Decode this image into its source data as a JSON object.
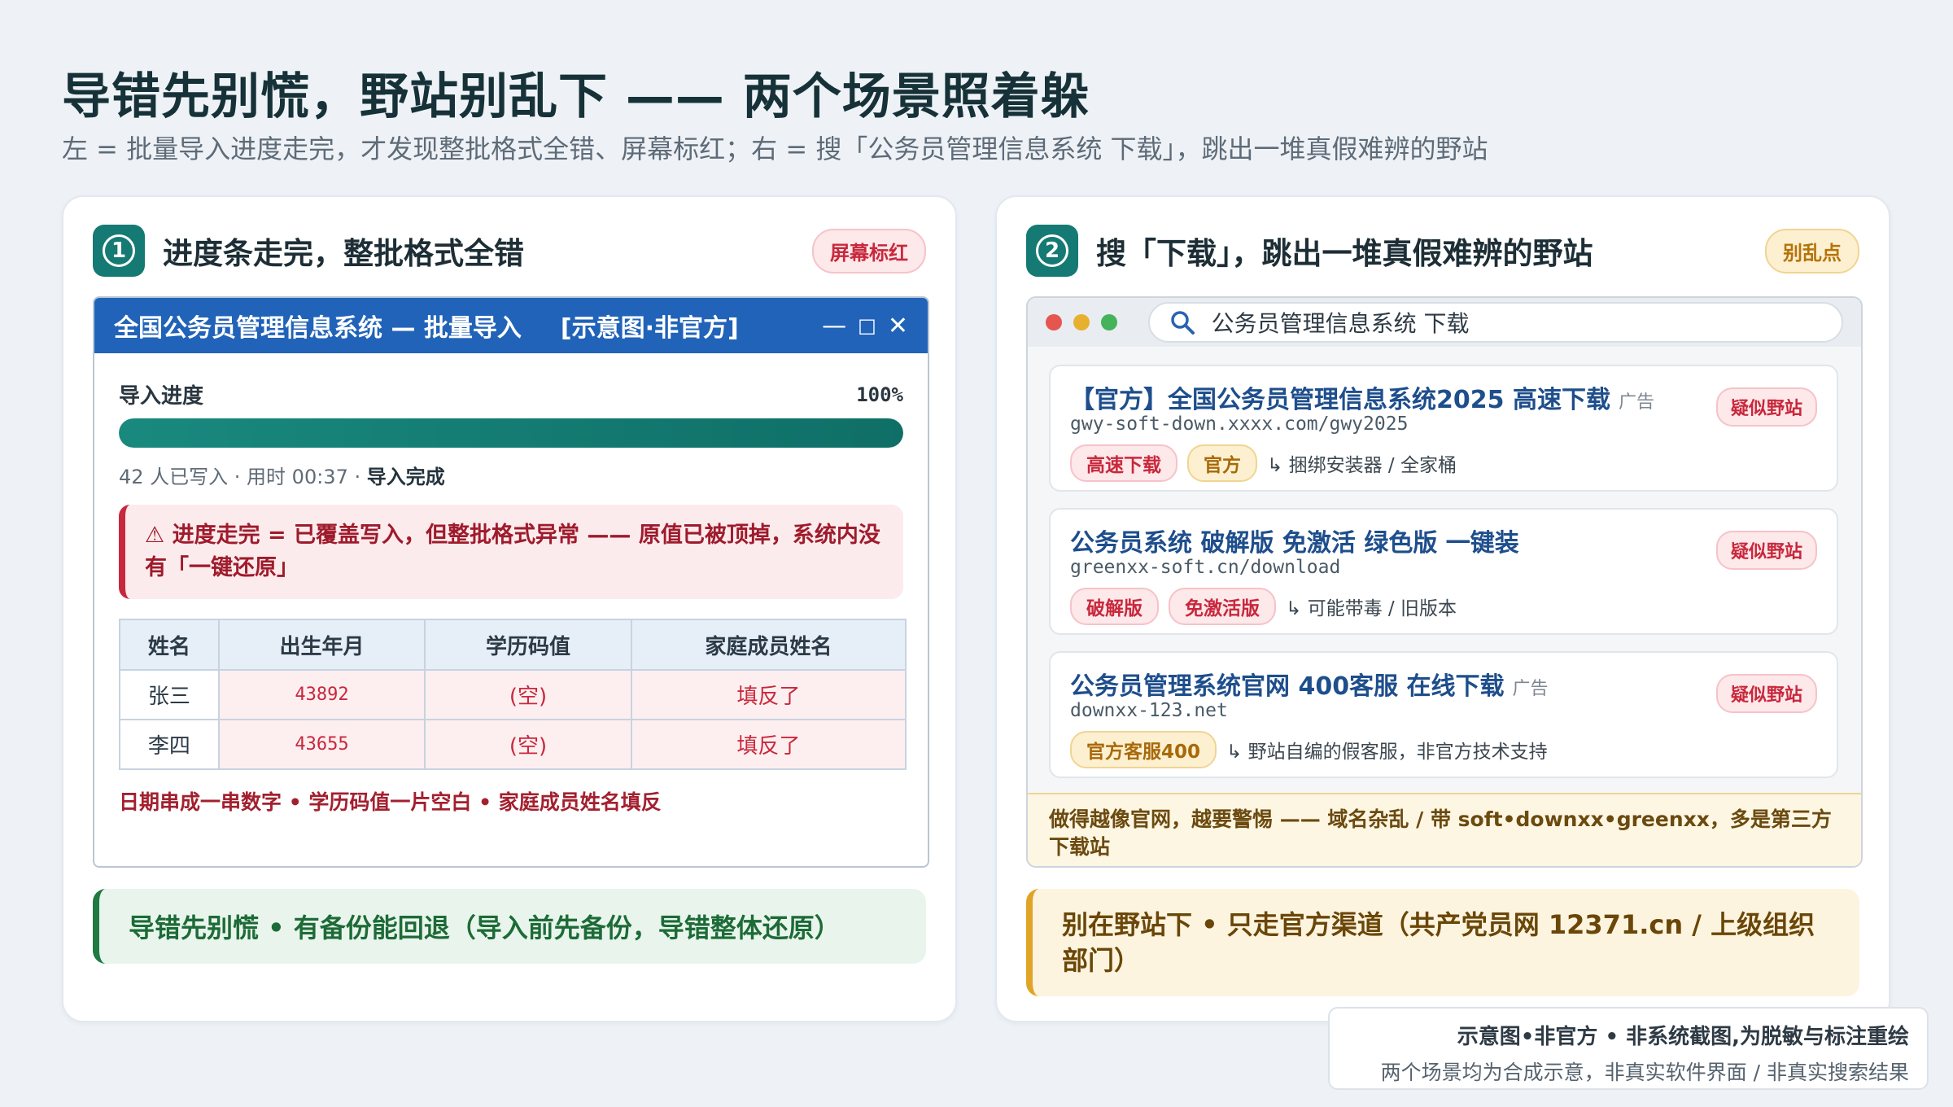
{
  "header": {
    "title": "导错先别慌，野站别乱下 —— 两个场景照着躲",
    "subtitle": "左 = 批量导入进度走完，才发现整批格式全错、屏幕标红；右 = 搜「公务员管理信息系统 下载」，跳出一堆真假难辨的野站"
  },
  "left": {
    "badge": "1",
    "title": "进度条走完，整批格式全错",
    "tag": "屏幕标红",
    "window": {
      "title": "全国公务员管理信息系统 — 批量导入",
      "tag": "[示意图·非官方]",
      "controls": {
        "minimize": "—",
        "maximize": "□",
        "close": "✕"
      },
      "progress_label": "导入进度",
      "progress_pct_text": "100%",
      "progress_value": 1.0,
      "meta_text": "42 人已写入 · 用时 00:37 · ",
      "meta_status": "导入完成",
      "alert": "⚠ 进度走完 = 已覆盖写入，但整批格式异常 —— 原值已被顶掉，系统内没有「一键还原」",
      "table": {
        "headers": [
          "姓名",
          "出生年月",
          "学历码值",
          "家庭成员姓名"
        ],
        "rows": [
          [
            "张三",
            "43892",
            "(空)",
            "填反了"
          ],
          [
            "李四",
            "43655",
            "(空)",
            "填反了"
          ]
        ]
      },
      "footer": "日期串成一串数字 • 学历码值一片空白 • 家庭成员姓名填反"
    },
    "callout": "导错先别慌 • 有备份能回退（导入前先备份，导错整体还原）"
  },
  "right": {
    "badge": "2",
    "title": "搜「下载」，跳出一堆真假难辨的野站",
    "tag": "别乱点",
    "browser": {
      "search_query": "公务员管理信息系统 下载",
      "results": [
        {
          "title": "【官方】全国公务员管理信息系统2025 高速下载",
          "ad": "广告",
          "url": "gwy-soft-down.xxxx.com/gwy2025",
          "chips": [
            {
              "text": "高速下载",
              "style": "red"
            },
            {
              "text": "官方",
              "style": "amber"
            }
          ],
          "note": "↳ 捆绑安装器 / 全家桶",
          "flag": "疑似野站"
        },
        {
          "title": "公务员系统 破解版 免激活 绿色版 一键装",
          "ad": "",
          "url": "greenxx-soft.cn/download",
          "chips": [
            {
              "text": "破解版",
              "style": "red"
            },
            {
              "text": "免激活版",
              "style": "red"
            }
          ],
          "note": "↳ 可能带毒 / 旧版本",
          "flag": "疑似野站"
        },
        {
          "title": "公务员管理系统官网 400客服 在线下载",
          "ad": "广告",
          "url": "downxx-123.net",
          "chips": [
            {
              "text": "官方客服400",
              "style": "amber"
            }
          ],
          "note": "↳ 野站自编的假客服，非官方技术支持",
          "flag": "疑似野站"
        }
      ],
      "warning": "做得越像官网，越要警惕 —— 域名杂乱 / 带 soft•downxx•greenxx，多是第三方下载站"
    },
    "callout": "别在野站下 • 只走官方渠道（共产党员网 12371.cn / 上级组织部门）"
  },
  "footnote": {
    "main": "示意图•非官方 • 非系统截图,为脱敏与标注重绘",
    "sub": "两个场景均为合成示意，非真实软件界面 / 非真实搜索结果"
  },
  "colors": {
    "accent_teal": "#157a73",
    "window_bar_blue": "#2163b8",
    "alert_red": "#c8283c",
    "warn_amber": "#e0a526",
    "ok_green": "#207a41"
  }
}
